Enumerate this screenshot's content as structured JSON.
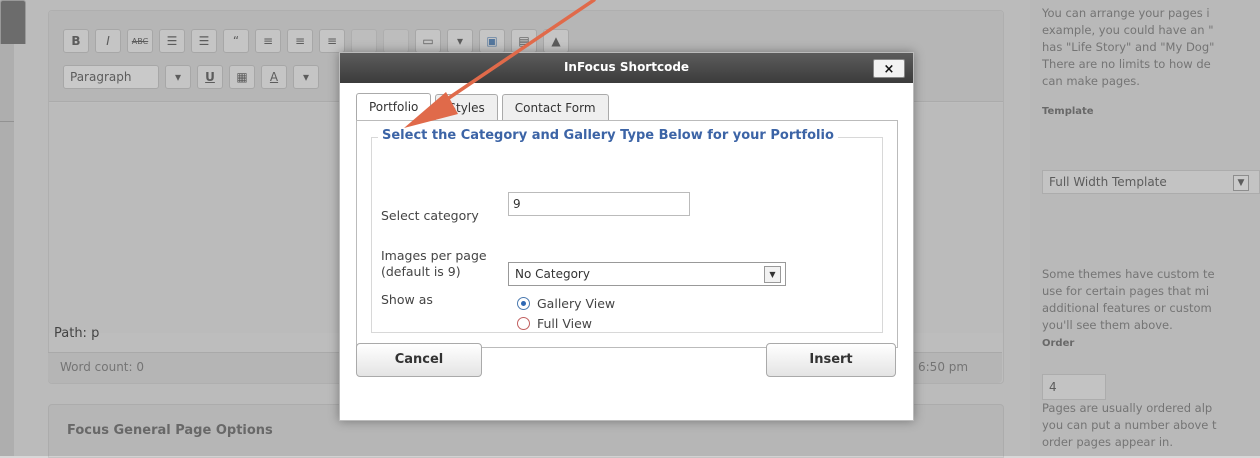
{
  "editor": {
    "toolbar_row1": [
      "B",
      "I",
      "ABC",
      "☰",
      "☰",
      "“",
      "≡",
      "≡",
      "≡",
      "",
      "",
      "▭",
      "▾",
      "▣",
      "▤",
      "▲"
    ],
    "format_select": "Paragraph",
    "toolbar_row2": [
      "▾",
      "U",
      "▦",
      "A",
      "▾"
    ],
    "path": "Path: p",
    "word_count": "Word count: 0",
    "time": "6:50 pm",
    "panel_title": "Focus General Page Options"
  },
  "sidebar": {
    "intro_lines": [
      "You can arrange your pages i",
      "example, you could have an \"",
      "has \"Life Story\" and \"My Dog\"",
      "There are no limits to how de",
      "can make pages."
    ],
    "template_label": "Template",
    "template_value": "Full Width Template",
    "template_lines": [
      "Some themes have custom te",
      "use for certain pages that mi",
      "additional features or custom",
      "you'll see them above."
    ],
    "order_label": "Order",
    "order_value": "4",
    "order_lines": [
      "Pages are usually ordered alp",
      "you can put a number above t",
      "order pages appear in."
    ]
  },
  "modal": {
    "title": "InFocus Shortcode",
    "close": "×",
    "tabs": [
      "Portfolio",
      "Styles",
      "Contact Form"
    ],
    "legend": "Select the Category and Gallery Type Below for your Portfolio",
    "select_category_label": "Select category",
    "select_category_value": "No Category",
    "images_label_1": "Images per page",
    "images_label_2": "(default is 9)",
    "images_value": "9",
    "show_as_label": "Show as",
    "options": [
      "Gallery View",
      "Full View"
    ],
    "selected_option": "Gallery View",
    "cancel": "Cancel",
    "insert": "Insert"
  },
  "colors": {
    "legend": "#3c64a6",
    "annotation_arrow": "#e06a4a",
    "titlebar": "#444444"
  },
  "icons": {
    "close": "close-icon",
    "select_arrow": "chevron-down-icon",
    "annotation": "arrow-annotation-icon"
  }
}
